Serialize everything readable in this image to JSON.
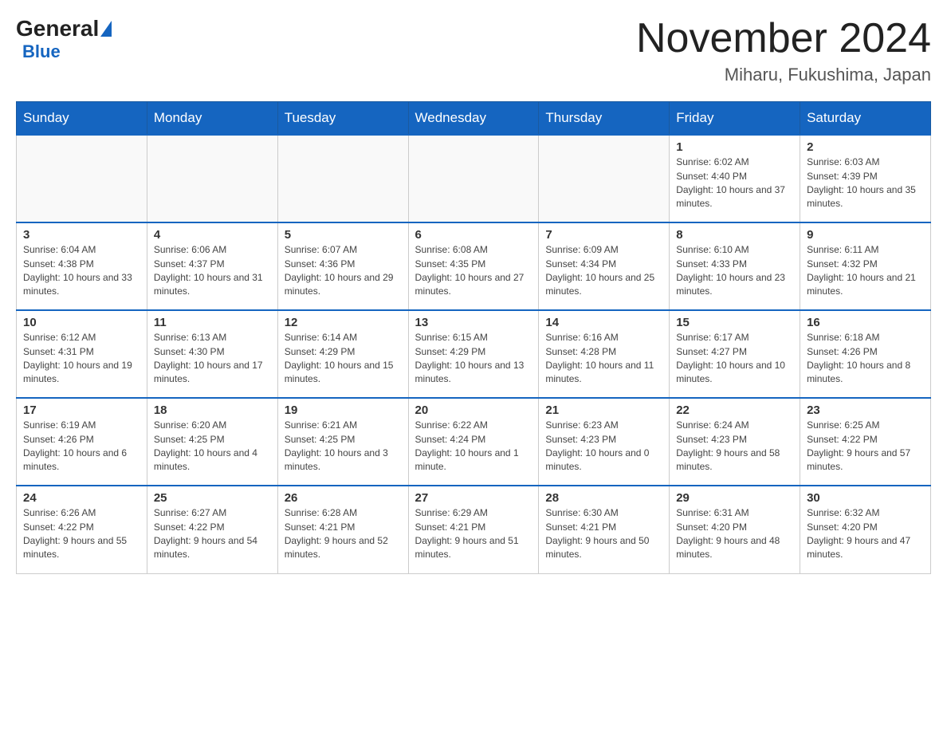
{
  "header": {
    "logo_general": "General",
    "logo_blue": "Blue",
    "month_title": "November 2024",
    "location": "Miharu, Fukushima, Japan"
  },
  "weekdays": [
    "Sunday",
    "Monday",
    "Tuesday",
    "Wednesday",
    "Thursday",
    "Friday",
    "Saturday"
  ],
  "weeks": [
    [
      {
        "day": "",
        "empty": true
      },
      {
        "day": "",
        "empty": true
      },
      {
        "day": "",
        "empty": true
      },
      {
        "day": "",
        "empty": true
      },
      {
        "day": "",
        "empty": true
      },
      {
        "day": "1",
        "sunrise": "6:02 AM",
        "sunset": "4:40 PM",
        "daylight": "10 hours and 37 minutes."
      },
      {
        "day": "2",
        "sunrise": "6:03 AM",
        "sunset": "4:39 PM",
        "daylight": "10 hours and 35 minutes."
      }
    ],
    [
      {
        "day": "3",
        "sunrise": "6:04 AM",
        "sunset": "4:38 PM",
        "daylight": "10 hours and 33 minutes."
      },
      {
        "day": "4",
        "sunrise": "6:06 AM",
        "sunset": "4:37 PM",
        "daylight": "10 hours and 31 minutes."
      },
      {
        "day": "5",
        "sunrise": "6:07 AM",
        "sunset": "4:36 PM",
        "daylight": "10 hours and 29 minutes."
      },
      {
        "day": "6",
        "sunrise": "6:08 AM",
        "sunset": "4:35 PM",
        "daylight": "10 hours and 27 minutes."
      },
      {
        "day": "7",
        "sunrise": "6:09 AM",
        "sunset": "4:34 PM",
        "daylight": "10 hours and 25 minutes."
      },
      {
        "day": "8",
        "sunrise": "6:10 AM",
        "sunset": "4:33 PM",
        "daylight": "10 hours and 23 minutes."
      },
      {
        "day": "9",
        "sunrise": "6:11 AM",
        "sunset": "4:32 PM",
        "daylight": "10 hours and 21 minutes."
      }
    ],
    [
      {
        "day": "10",
        "sunrise": "6:12 AM",
        "sunset": "4:31 PM",
        "daylight": "10 hours and 19 minutes."
      },
      {
        "day": "11",
        "sunrise": "6:13 AM",
        "sunset": "4:30 PM",
        "daylight": "10 hours and 17 minutes."
      },
      {
        "day": "12",
        "sunrise": "6:14 AM",
        "sunset": "4:29 PM",
        "daylight": "10 hours and 15 minutes."
      },
      {
        "day": "13",
        "sunrise": "6:15 AM",
        "sunset": "4:29 PM",
        "daylight": "10 hours and 13 minutes."
      },
      {
        "day": "14",
        "sunrise": "6:16 AM",
        "sunset": "4:28 PM",
        "daylight": "10 hours and 11 minutes."
      },
      {
        "day": "15",
        "sunrise": "6:17 AM",
        "sunset": "4:27 PM",
        "daylight": "10 hours and 10 minutes."
      },
      {
        "day": "16",
        "sunrise": "6:18 AM",
        "sunset": "4:26 PM",
        "daylight": "10 hours and 8 minutes."
      }
    ],
    [
      {
        "day": "17",
        "sunrise": "6:19 AM",
        "sunset": "4:26 PM",
        "daylight": "10 hours and 6 minutes."
      },
      {
        "day": "18",
        "sunrise": "6:20 AM",
        "sunset": "4:25 PM",
        "daylight": "10 hours and 4 minutes."
      },
      {
        "day": "19",
        "sunrise": "6:21 AM",
        "sunset": "4:25 PM",
        "daylight": "10 hours and 3 minutes."
      },
      {
        "day": "20",
        "sunrise": "6:22 AM",
        "sunset": "4:24 PM",
        "daylight": "10 hours and 1 minute."
      },
      {
        "day": "21",
        "sunrise": "6:23 AM",
        "sunset": "4:23 PM",
        "daylight": "10 hours and 0 minutes."
      },
      {
        "day": "22",
        "sunrise": "6:24 AM",
        "sunset": "4:23 PM",
        "daylight": "9 hours and 58 minutes."
      },
      {
        "day": "23",
        "sunrise": "6:25 AM",
        "sunset": "4:22 PM",
        "daylight": "9 hours and 57 minutes."
      }
    ],
    [
      {
        "day": "24",
        "sunrise": "6:26 AM",
        "sunset": "4:22 PM",
        "daylight": "9 hours and 55 minutes."
      },
      {
        "day": "25",
        "sunrise": "6:27 AM",
        "sunset": "4:22 PM",
        "daylight": "9 hours and 54 minutes."
      },
      {
        "day": "26",
        "sunrise": "6:28 AM",
        "sunset": "4:21 PM",
        "daylight": "9 hours and 52 minutes."
      },
      {
        "day": "27",
        "sunrise": "6:29 AM",
        "sunset": "4:21 PM",
        "daylight": "9 hours and 51 minutes."
      },
      {
        "day": "28",
        "sunrise": "6:30 AM",
        "sunset": "4:21 PM",
        "daylight": "9 hours and 50 minutes."
      },
      {
        "day": "29",
        "sunrise": "6:31 AM",
        "sunset": "4:20 PM",
        "daylight": "9 hours and 48 minutes."
      },
      {
        "day": "30",
        "sunrise": "6:32 AM",
        "sunset": "4:20 PM",
        "daylight": "9 hours and 47 minutes."
      }
    ]
  ]
}
